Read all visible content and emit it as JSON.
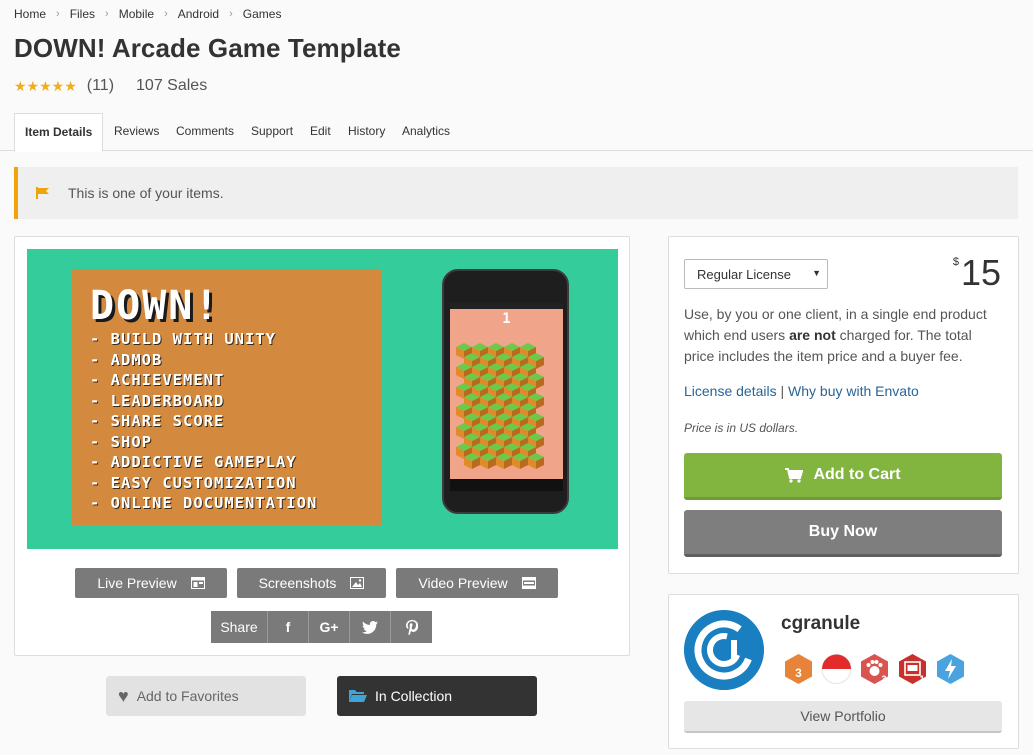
{
  "breadcrumb": [
    "Home",
    "Files",
    "Mobile",
    "Android",
    "Games"
  ],
  "title": "DOWN! Arcade Game Template",
  "rating": {
    "stars": "★★★★★",
    "value": 5,
    "count": "(11)"
  },
  "sales": "107 Sales",
  "tabs": [
    "Item Details",
    "Reviews",
    "Comments",
    "Support",
    "Edit",
    "History",
    "Analytics"
  ],
  "notice": "This is one of your items.",
  "banner": {
    "game_title": "DOWN!",
    "features": [
      "- BUILD WITH UNITY",
      "- ADMOB",
      "- ACHIEVEMENT",
      "- LEADERBOARD",
      "- SHARE SCORE",
      "- SHOP",
      "- ADDICTIVE GAMEPLAY",
      "- EASY CUSTOMIZATION",
      "- ONLINE DOCUMENTATION"
    ],
    "phone_score": "1"
  },
  "preview_buttons": {
    "live": "Live Preview",
    "screenshots": "Screenshots",
    "video": "Video Preview"
  },
  "share": {
    "label": "Share",
    "icons": [
      "facebook-icon",
      "google-plus-icon",
      "twitter-icon",
      "pinterest-icon"
    ],
    "glyphs": [
      "f",
      "G+",
      "🐦",
      "P"
    ]
  },
  "favorites": "Add to Favorites",
  "collection": "In Collection",
  "purchase": {
    "license": "Regular License",
    "currency": "$",
    "price": "15",
    "desc_1": "Use, by you or one client, in a single end product which end users ",
    "desc_bold": "are not",
    "desc_2": " charged for. The total price includes the item price and a buyer fee.",
    "license_details": "License details",
    "why_envato": "Why buy with Envato",
    "price_note": "Price is in US dollars.",
    "add_to_cart": "Add to Cart",
    "buy_now": "Buy Now"
  },
  "author": {
    "name": "cgranule",
    "view_portfolio": "View Portfolio",
    "badges": [
      {
        "icon": "level-badge-icon",
        "label": "3",
        "color": "#e8833a"
      },
      {
        "icon": "country-flag-icon",
        "label": "",
        "color": "#e32b2b"
      },
      {
        "icon": "paw-badge-icon",
        "label": "3",
        "color": "#d9534f"
      },
      {
        "icon": "collector-badge-icon",
        "label": "1",
        "color": "#c9302c"
      },
      {
        "icon": "power-elite-icon",
        "label": "",
        "color": "#4aa3df"
      }
    ]
  },
  "colors": {
    "accent_green": "#82b440",
    "banner_teal": "#35cc9c",
    "banner_orange": "#d48a3e",
    "notice_bar": "#f0a30a"
  }
}
